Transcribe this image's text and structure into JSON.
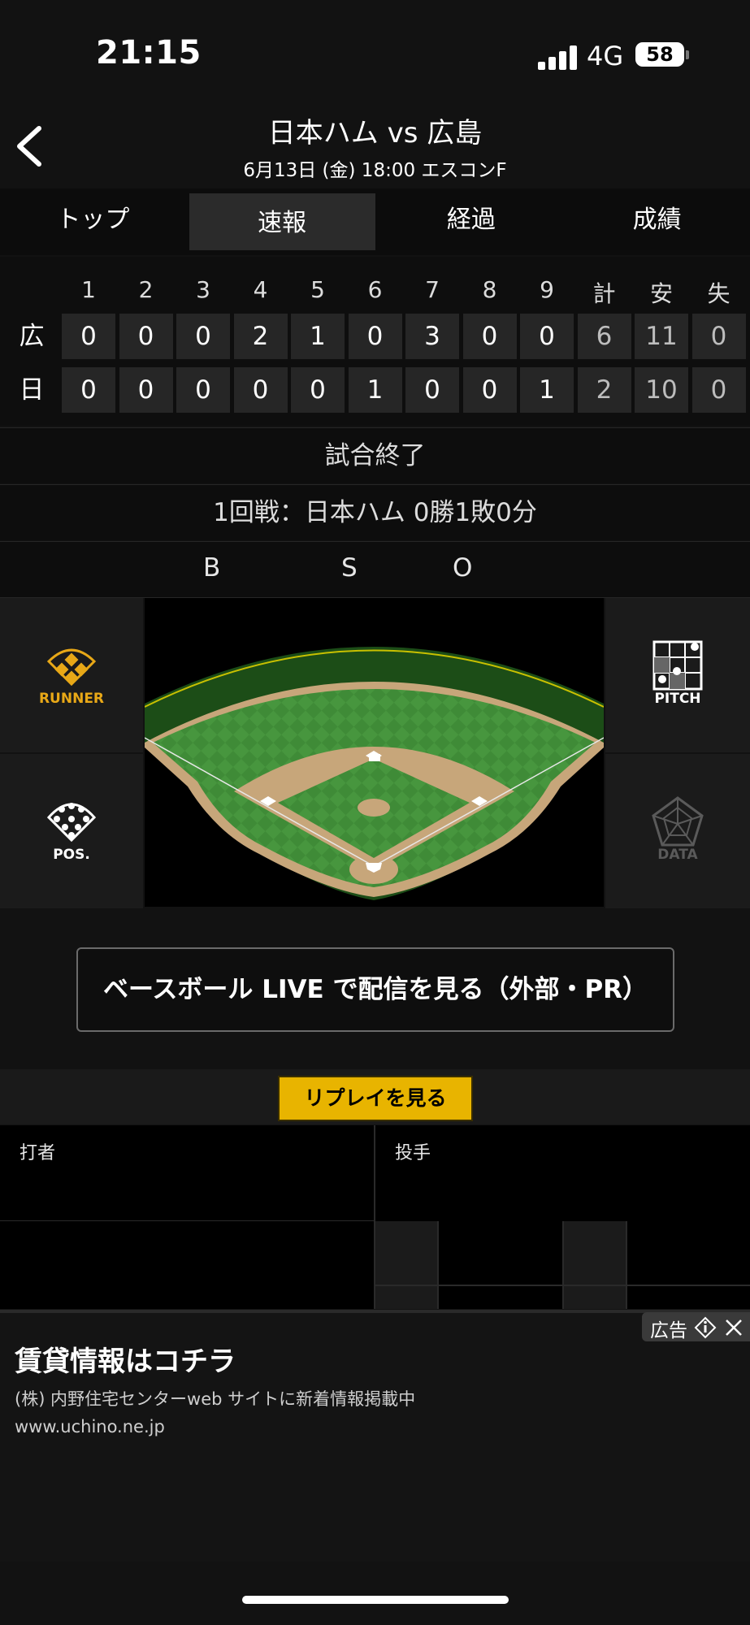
{
  "status": {
    "time": "21:15",
    "network": "4G",
    "battery": "58"
  },
  "header": {
    "title": "日本ハム vs 広島",
    "subtitle": "6月13日 (金) 18:00 エスコンF"
  },
  "tabs": [
    {
      "label": "トップ"
    },
    {
      "label": "速報"
    },
    {
      "label": "経過"
    },
    {
      "label": "成績"
    }
  ],
  "active_tab": "速報",
  "scoreboard": {
    "headers": [
      "1",
      "2",
      "3",
      "4",
      "5",
      "6",
      "7",
      "8",
      "9",
      "計",
      "安",
      "失"
    ],
    "teams": [
      {
        "name": "広",
        "scores": [
          "0",
          "0",
          "0",
          "2",
          "1",
          "0",
          "3",
          "0",
          "0",
          "6",
          "11",
          "0"
        ]
      },
      {
        "name": "日",
        "scores": [
          "0",
          "0",
          "0",
          "0",
          "0",
          "1",
          "0",
          "0",
          "1",
          "2",
          "10",
          "0"
        ]
      }
    ]
  },
  "game_status": "試合終了",
  "series": "1回戦：日本ハム 0勝1敗0分",
  "bso": {
    "b": "B",
    "s": "S",
    "o": "O"
  },
  "field_buttons": {
    "runner": "RUNNER",
    "pos": "POS.",
    "pitch": "PITCH",
    "data": "DATA"
  },
  "colors": {
    "accent": "#E8A817",
    "replay": "#E8B400",
    "grass": "#3E8A36",
    "dirt": "#C7A67A"
  },
  "live_button": "ベースボール LIVE で配信を見る（外部・PR）",
  "replay_button": "リプレイを見る",
  "batter_label": "打者",
  "pitcher_label": "投手",
  "ad": {
    "badge": "広告",
    "title": "賃貸情報はコチラ",
    "description": "(株) 内野住宅センターweb サイトに新着情報掲載中",
    "url": "www.uchino.ne.jp"
  }
}
